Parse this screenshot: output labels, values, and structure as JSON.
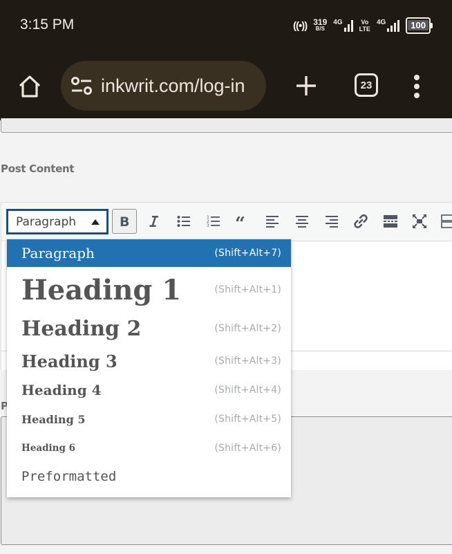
{
  "status_bar": {
    "time": "3:15 PM",
    "hotspot_count": "1",
    "net_speed_value": "319",
    "net_speed_unit": "B/S",
    "sim1_network": "4G",
    "volte_top": "Vo",
    "volte_bottom": "LTE",
    "sim2_network": "4G",
    "battery_level": "100"
  },
  "browser": {
    "url": "inkwrit.com/log-in",
    "tab_count": "23",
    "icons": {
      "home": "home-icon",
      "site_settings": "tune-icon",
      "new_tab": "plus-icon",
      "tabs": "tab-switcher-icon",
      "menu": "more-vert-icon"
    }
  },
  "page": {
    "post_content_label": "Post Content",
    "hidden_label_initial": "P",
    "editor": {
      "format_select_value": "Paragraph",
      "toolbar_buttons": [
        {
          "name": "bold",
          "icon": "bold-icon",
          "active": true
        },
        {
          "name": "italic",
          "icon": "italic-icon"
        },
        {
          "name": "bullet-list",
          "icon": "bullet-list-icon"
        },
        {
          "name": "numbered-list",
          "icon": "numbered-list-icon"
        },
        {
          "name": "blockquote",
          "icon": "quote-icon"
        },
        {
          "name": "align-left",
          "icon": "align-left-icon"
        },
        {
          "name": "align-center",
          "icon": "align-center-icon"
        },
        {
          "name": "align-right",
          "icon": "align-right-icon"
        },
        {
          "name": "insert-link",
          "icon": "link-icon"
        },
        {
          "name": "read-more",
          "icon": "read-more-icon"
        },
        {
          "name": "fullscreen",
          "icon": "fullscreen-icon"
        },
        {
          "name": "toolbar-toggle",
          "icon": "keyboard-icon"
        }
      ]
    },
    "format_dropdown": {
      "items": [
        {
          "label": "Paragraph",
          "shortcut": "(Shift+Alt+7)",
          "selected": true
        },
        {
          "label": "Heading 1",
          "shortcut": "(Shift+Alt+1)"
        },
        {
          "label": "Heading 2",
          "shortcut": "(Shift+Alt+2)"
        },
        {
          "label": "Heading 3",
          "shortcut": "(Shift+Alt+3)"
        },
        {
          "label": "Heading 4",
          "shortcut": "(Shift+Alt+4)"
        },
        {
          "label": "Heading 5",
          "shortcut": "(Shift+Alt+5)"
        },
        {
          "label": "Heading 6",
          "shortcut": "(Shift+Alt+6)"
        },
        {
          "label": "Preformatted",
          "shortcut": ""
        }
      ]
    }
  },
  "colors": {
    "system_bar_bg": "#1f1a14",
    "url_pill_bg": "#3a3022",
    "selected_item_bg": "#2271b1",
    "select_border": "#1d4e7a",
    "page_bg": "#f3f3f3"
  }
}
